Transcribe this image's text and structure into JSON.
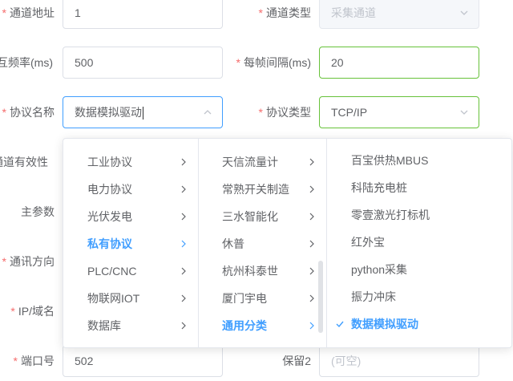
{
  "form": {
    "channel_address": {
      "label": "通道地址",
      "value": "1"
    },
    "channel_type": {
      "label": "通道类型",
      "value": "采集通道"
    },
    "interval": {
      "label": "互频率(ms)",
      "value": "500"
    },
    "frame_interval": {
      "label": "每帧间隔(ms)",
      "value": "20"
    },
    "protocol_name": {
      "label": "协议名称",
      "value": "数据模拟驱动"
    },
    "protocol_type": {
      "label": "协议类型",
      "value": "TCP/IP"
    },
    "channel_valid": {
      "label": "通道有效性"
    },
    "main_params": {
      "label": "主参数"
    },
    "comm_direction": {
      "label": "通讯方向"
    },
    "ip_domain": {
      "label": "IP/域名"
    },
    "port": {
      "label": "端口号",
      "value": "502"
    },
    "reserve2": {
      "label": "保留2",
      "placeholder": "(可空)"
    }
  },
  "cascader": {
    "level1": [
      "工业协议",
      "电力协议",
      "光伏发电",
      "私有协议",
      "PLC/CNC",
      "物联网IOT",
      "数据库"
    ],
    "level1_active": "私有协议",
    "level2": [
      "天信流量计",
      "常熟开关制造",
      "三水智能化",
      "休普",
      "杭州科泰世",
      "厦门宇电",
      "通用分类"
    ],
    "level2_active": "通用分类",
    "level3": [
      "百宝供热MBUS",
      "科陆充电桩",
      "零壹激光打标机",
      "红外宝",
      "python采集",
      "振力冲床",
      "数据模拟驱动"
    ],
    "level3_selected": "数据模拟驱动"
  },
  "colors": {
    "accent": "#409eff",
    "success": "#67c23a",
    "required": "#f56c6c",
    "text": "#606266",
    "border": "#dcdfe6"
  },
  "icons": {
    "select_arrow": "chevron-down-icon",
    "select_open_arrow": "chevron-up-icon",
    "submenu": "chevron-right-icon",
    "selected": "check-icon"
  }
}
